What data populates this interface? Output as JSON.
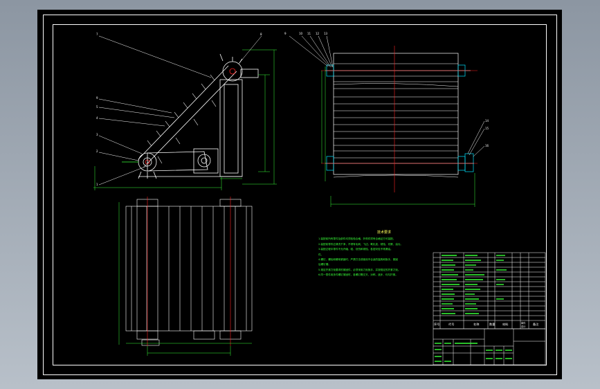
{
  "drawing": {
    "background_color": "#000000",
    "frame_color": "#ffffff",
    "line_color": "#ffffff",
    "dimension_color": "#39ff39",
    "centerline_color": "#ff2020",
    "hatch_color": "#00e5ff",
    "note_title_color": "#ffff5a"
  },
  "callouts_side": [
    "7",
    "8",
    "9",
    "5",
    "4",
    "3",
    "2",
    "1"
  ],
  "callouts_top": [
    "9",
    "10",
    "11",
    "12",
    "13"
  ],
  "callouts_right": [
    "14",
    "15",
    "16"
  ],
  "notes": {
    "title": "技术要求",
    "lines": [
      "1.装配前所有零件及部件均须检验合格，外购件须有合格证方可装配。",
      "2.装配前零件应清洗干净，不得有毛刺、飞边、氧化皮、锈蚀、切屑、油污。",
      "3.装配过程中零件不允许磕、碰、划伤和锈蚀，各密封处不得漏油。",
      "件。",
      "4.螺钉、螺栓和螺母紧固时，严禁打击或使用不合适的旋具和扳手，紧固",
      "后螺钉槽。",
      "5.规定拧紧力矩要求的紧固件，必须采用力矩扳手，并按规定的拧紧力矩。",
      "6.同一零件用多件螺钉紧固时，各螺钉需交叉、对称、逐步、均匀拧紧。"
    ]
  },
  "bom": {
    "header": [
      "序号",
      "代号",
      "名称",
      "数量",
      "材料",
      "单件",
      "总计",
      "备注"
    ]
  }
}
